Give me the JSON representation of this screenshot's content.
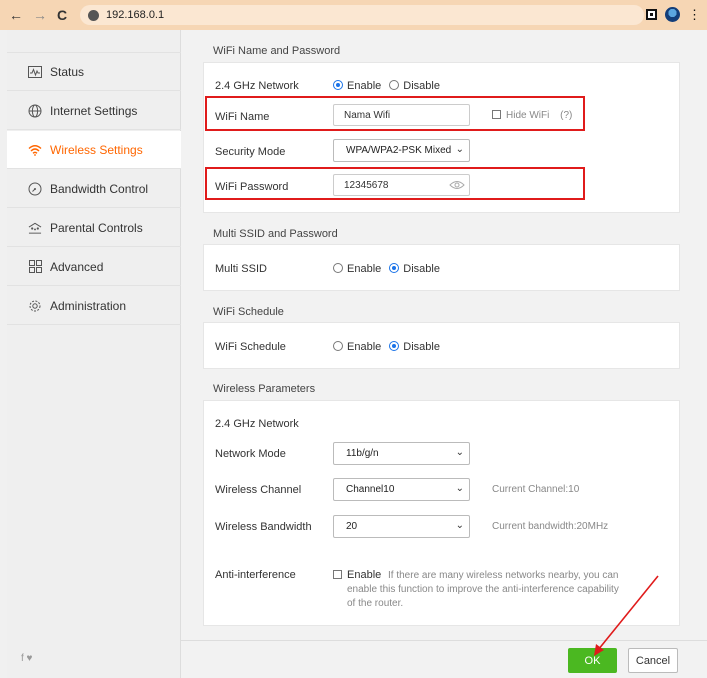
{
  "browser": {
    "url": "192.168.0.1"
  },
  "sidebar": {
    "items": [
      {
        "label": "Status",
        "icon": "status-icon"
      },
      {
        "label": "Internet Settings",
        "icon": "globe-icon"
      },
      {
        "label": "Wireless Settings",
        "icon": "wifi-icon",
        "active": true
      },
      {
        "label": "Bandwidth Control",
        "icon": "gauge-icon"
      },
      {
        "label": "Parental Controls",
        "icon": "family-icon"
      },
      {
        "label": "Advanced",
        "icon": "grid-icon"
      },
      {
        "label": "Administration",
        "icon": "gear-icon"
      }
    ],
    "social": "f  ♥"
  },
  "wifi_name_password": {
    "title": "WiFi Name and Password",
    "network_label": "2.4 GHz Network",
    "enable_label": "Enable",
    "disable_label": "Disable",
    "enabled": true,
    "wifi_name_label": "WiFi Name",
    "wifi_name_value": "Nama Wifi",
    "hide_wifi_label": "Hide WiFi",
    "help_label": "(?)",
    "security_mode_label": "Security Mode",
    "security_mode_value": "WPA/WPA2-PSK Mixed",
    "wifi_password_label": "WiFi Password",
    "wifi_password_value": "12345678"
  },
  "multi_ssid": {
    "title": "Multi SSID and Password",
    "label": "Multi SSID",
    "enable_label": "Enable",
    "disable_label": "Disable"
  },
  "wifi_schedule": {
    "title": "WiFi Schedule",
    "label": "WiFi Schedule",
    "enable_label": "Enable",
    "disable_label": "Disable"
  },
  "wireless_params": {
    "title": "Wireless Parameters",
    "network_label": "2.4 GHz Network",
    "network_mode_label": "Network Mode",
    "network_mode_value": "11b/g/n",
    "channel_label": "Wireless Channel",
    "channel_value": "Channel10",
    "current_channel": "Current Channel:10",
    "bandwidth_label": "Wireless Bandwidth",
    "bandwidth_value": "20",
    "current_bandwidth": "Current bandwidth:20MHz",
    "anti_label": "Anti-interference",
    "anti_enable": "Enable",
    "anti_desc_1": "If there are many wireless networks nearby, you can",
    "anti_desc_2": "enable this function to improve the anti-interference capability",
    "anti_desc_3": "of the router."
  },
  "footer": {
    "ok_label": "OK",
    "cancel_label": "Cancel"
  },
  "colors": {
    "accent": "#ff6600",
    "ok_green": "#4bb821",
    "highlight_red": "#e01b1b",
    "radio_blue": "#1a73e8"
  }
}
